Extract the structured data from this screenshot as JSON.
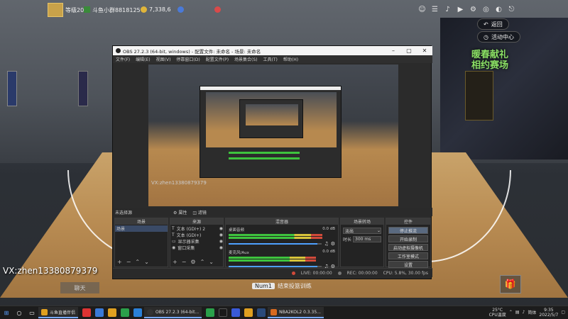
{
  "hud": {
    "level": "等级20",
    "username": "斗鱼小群8818125",
    "coins": "7,338,6",
    "stat2": "",
    "stat3": "",
    "buttons": {
      "return_label": "返回",
      "activity_label": "活动中心"
    }
  },
  "game": {
    "promo_line1": "暖春献礼",
    "promo_line2": "相约赛场",
    "vx_text": "VX:zhen13380879379",
    "chat_label": "聊天",
    "hint_key": "Num1",
    "hint_text": "结束投篮训练"
  },
  "obs": {
    "title": "OBS 27.2.3 (64-bit, windows) - 配置文件: 未命名 - 场景: 未命名",
    "menu": [
      "文件(F)",
      "编辑(E)",
      "视图(V)",
      "停靠窗口(D)",
      "配置文件(P)",
      "场景集合(S)",
      "工具(T)",
      "帮助(H)"
    ],
    "preview_vx": "VX:zhen13380879379",
    "no_source_label": "未选择源",
    "props_label": "属性",
    "filters_label": "滤镜",
    "scenes": {
      "title": "场景",
      "items": [
        "场景"
      ]
    },
    "sources": {
      "title": "来源",
      "items": [
        {
          "icon": "T",
          "name": "文本 (GDI+) 2"
        },
        {
          "icon": "T",
          "name": "文本 (GDI+)"
        },
        {
          "icon": "▭",
          "name": "显示器采集"
        },
        {
          "icon": "◉",
          "name": "窗口采集"
        }
      ]
    },
    "mixer": {
      "title": "混音器",
      "channels": [
        {
          "name": "桌面音频",
          "db": "0.0 dB",
          "level": 0.88,
          "volume": 0.95
        },
        {
          "name": "麦克风/Aux",
          "db": "0.0 dB",
          "level": 0.82,
          "volume": 0.95
        }
      ]
    },
    "transitions": {
      "title": "场景转场",
      "type": "淡出",
      "duration_label": "时长",
      "duration": "300 ms"
    },
    "controls": {
      "title": "控件",
      "buttons": [
        "停止推流",
        "开始录制",
        "启动虚拟摄像机",
        "工作室模式",
        "设置",
        "退出"
      ]
    },
    "status": {
      "live": "LIVE: 00:00:00",
      "rec": "REC: 00:00:00",
      "cpu": "CPU: 5.8%, 30.00 fps"
    }
  },
  "taskbar": {
    "apps": [
      {
        "label": "斗鱼直播伴侣"
      },
      {
        "label": "OBS 27.2.3 (64-bit..."
      },
      {
        "label": "NBA2KOL2 0.3.35..."
      }
    ],
    "weather": "25°C",
    "weather_sub": "CPU温度",
    "ime": "简体",
    "time": "9:35",
    "date": "2022/5/7"
  },
  "colors": {
    "accent_green": "#3ec43e",
    "promo_green": "#8be065",
    "live_red": "#d24a3a"
  }
}
